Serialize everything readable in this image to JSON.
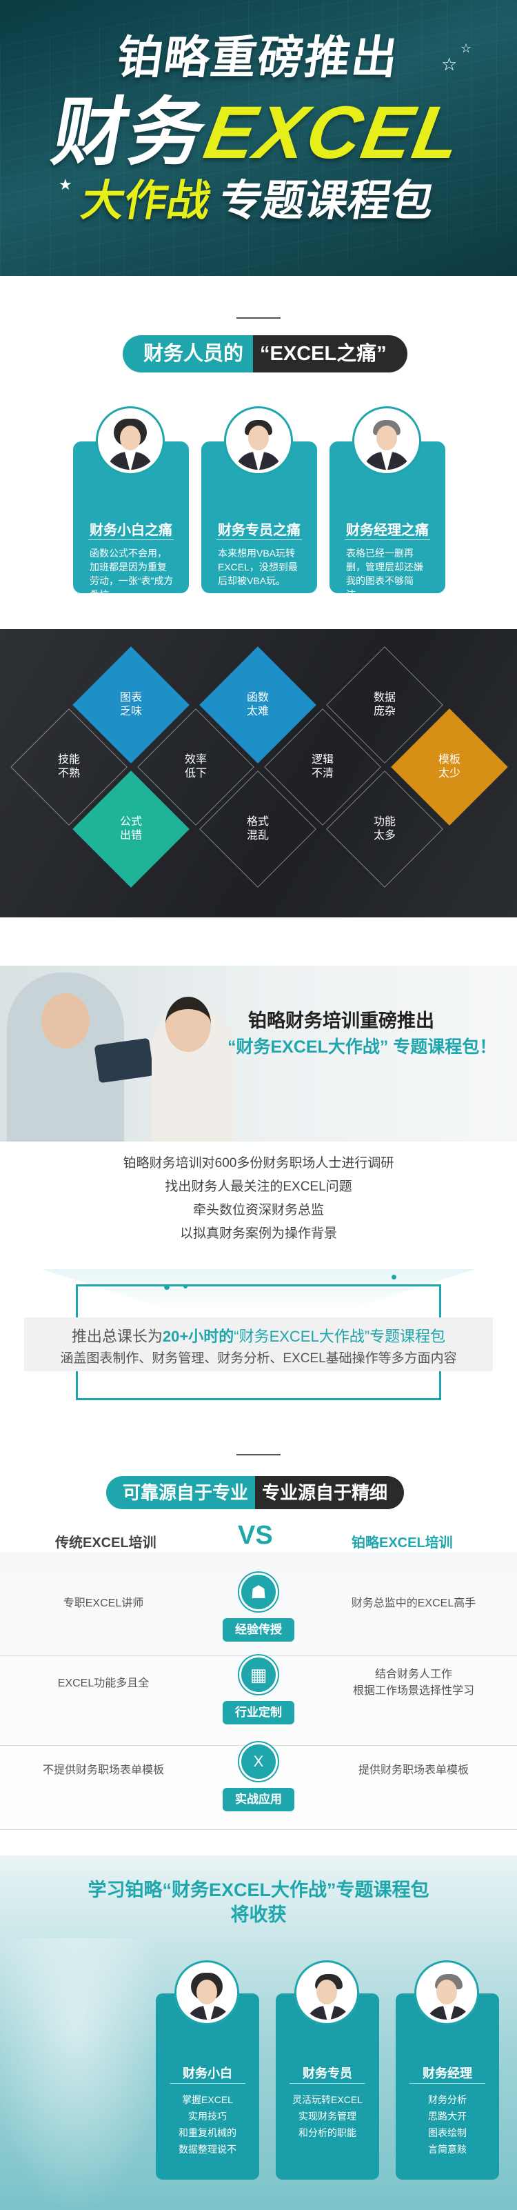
{
  "hero": {
    "line1": "铂略重磅推出",
    "line2_a": "财务",
    "line2_b": "EXCEL",
    "line3_a": "大作战",
    "line3_b": "专题课程包"
  },
  "pain": {
    "title_a": "财务人员的",
    "title_b": "“EXCEL之痛”",
    "cards": [
      {
        "title": "财务小白之痛",
        "desc": "函数公式不会用，加班都是因为重复劳动，一张“表”成方骨杭。"
      },
      {
        "title": "财务专员之痛",
        "desc": "本来想用VBA玩转EXCEL，没想到最后却被VBA玩。"
      },
      {
        "title": "财务经理之痛",
        "desc": "表格已经一删再删，管理层却还嫌我的图表不够简洁。"
      }
    ]
  },
  "diamonds": {
    "items": [
      "图表\n乏味",
      "函数\n太难",
      "数据\n庞杂",
      "技能\n不熟",
      "效率\n低下",
      "逻辑\n不清",
      "模板\n太少",
      "公式\n出错",
      "格式\n混乱",
      "功能\n太多"
    ],
    "colors": {
      "blue": "#1f8fc7",
      "green": "#1fb39a",
      "orange": "#d88f16"
    }
  },
  "promo": {
    "headline1": "铂略财务培训重磅推出",
    "headline2": "“财务EXCEL大作战” 专题课程包！",
    "list": [
      "铂略财务培训对600多份财务职场人士进行调研",
      "找出财务人最关注的EXCEL问题",
      "牵头数位资深财务总监",
      "以拟真财务案例为操作背景"
    ],
    "course_line1_a": "推出总课长为",
    "course_line1_b": "20+小时的",
    "course_line1_c": "“财务EXCEL大作战”",
    "course_line1_d": "专题课程包",
    "course_line2": "涵盖图表制作、财务管理、财务分析、EXCEL基础操作等多方面内容"
  },
  "compare": {
    "title_a": "可靠源自于专业",
    "title_b": "专业源自于精细",
    "left_header": "传统EXCEL培训",
    "vs": "VS",
    "right_header": "铂略EXCEL培训",
    "rows": [
      {
        "left": "专职EXCEL讲师",
        "badge": "经验传授",
        "right": "财务总监中的EXCEL高手"
      },
      {
        "left": "EXCEL功能多且全",
        "badge": "行业定制",
        "right": "结合财务人工作\n根据工作场景选择性学习"
      },
      {
        "left": "不提供财务职场表单模板",
        "badge": "实战应用",
        "right": "提供财务职场表单模板"
      }
    ]
  },
  "gain": {
    "title_line1": "学习铂略“财务EXCEL大作战”专题课程包",
    "title_line2": "将收获",
    "cards": [
      {
        "title": "财务小白",
        "desc": "掌握EXCEL\n实用技巧\n和重复机械的\n数据整理说不"
      },
      {
        "title": "财务专员",
        "desc": "灵活玩转EXCEL\n实现财务管理\n和分析的职能"
      },
      {
        "title": "财务经理",
        "desc": "财务分析\n思路大开\n图表绘制\n言简意赅"
      }
    ]
  }
}
